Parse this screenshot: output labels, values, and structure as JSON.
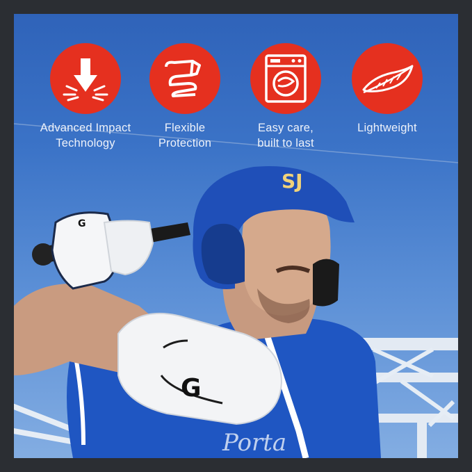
{
  "features": [
    {
      "icon": "impact-arrow-icon",
      "label": "Advanced Impact\nTechnology"
    },
    {
      "icon": "ribbon-icon",
      "label": "Flexible\nProtection"
    },
    {
      "icon": "washing-machine-icon",
      "label": "Easy care,\nbuilt to last"
    },
    {
      "icon": "feather-icon",
      "label": "Lightweight"
    }
  ],
  "colors": {
    "badge": "#e5301f",
    "sky": "#3b73c7",
    "jersey": "#1f56c2",
    "helmet": "#1f4fb8",
    "border": "#2b2e33"
  },
  "photo": {
    "helmet_logo": "SJ",
    "guard_logo": "G",
    "glove_logo": "G",
    "jersey_text": "Porta"
  }
}
